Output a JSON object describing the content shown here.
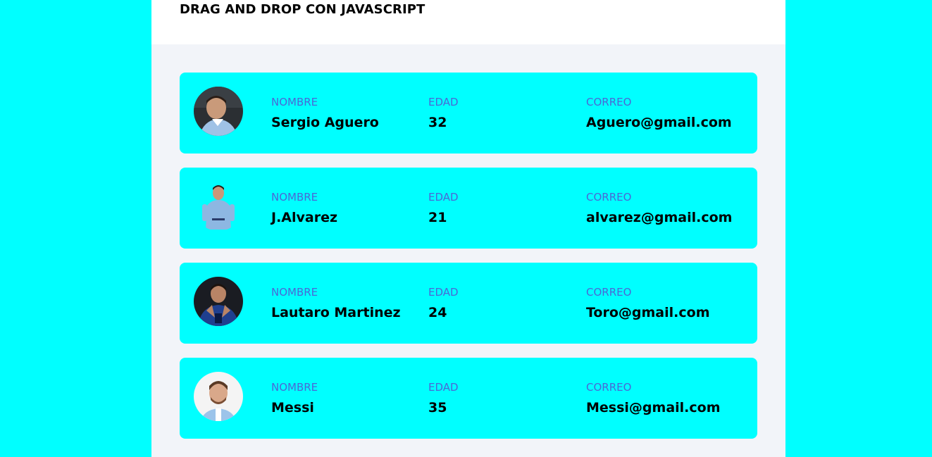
{
  "header": {
    "title": "DRAG AND DROP CON JAVASCRIPT"
  },
  "labels": {
    "name": "NOMBRE",
    "age": "EDAD",
    "email": "CORREO"
  },
  "players": [
    {
      "name": "Sergio Aguero",
      "age": "32",
      "email": "Aguero@gmail.com"
    },
    {
      "name": "J.Alvarez",
      "age": "21",
      "email": "alvarez@gmail.com"
    },
    {
      "name": "Lautaro Martinez",
      "age": "24",
      "email": "Toro@gmail.com"
    },
    {
      "name": "Messi",
      "age": "35",
      "email": "Messi@gmail.com"
    }
  ],
  "colors": {
    "background": "#00ffff",
    "panel": "#f2f4f9",
    "card": "#00ffff",
    "label": "#4a68d6"
  }
}
